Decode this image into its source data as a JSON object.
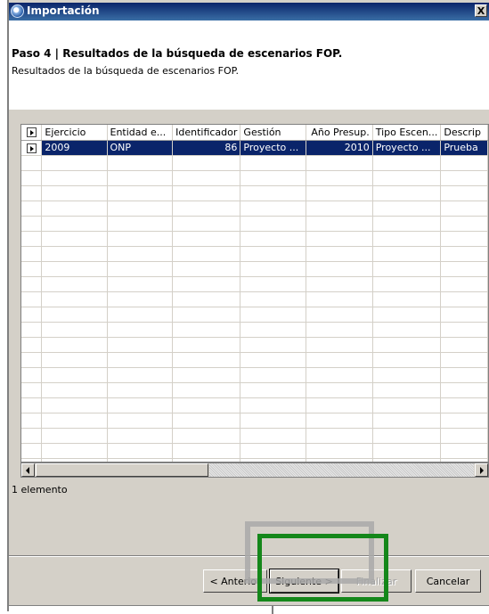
{
  "window": {
    "title": "Importación",
    "close_glyph": "X"
  },
  "header": {
    "step_title": "Paso 4 | Resultados de la búsqueda de escenarios FOP.",
    "step_description": "Resultados de la búsqueda de escenarios FOP."
  },
  "grid": {
    "columns": [
      "Ejercicio",
      "Entidad e...",
      "Identificador",
      "Gestión",
      "Año Presup.",
      "Tipo Escen...",
      "Descrip"
    ],
    "rows": [
      {
        "selected": true,
        "cells": [
          "2009",
          "ONP",
          "86",
          "Proyecto ...",
          "2010",
          "Proyecto ...",
          "Prueba"
        ]
      }
    ]
  },
  "status": {
    "count_label": "1 elemento"
  },
  "buttons": {
    "previous": "< Anterior",
    "next": "Siguiente >",
    "finish": "Finalizar",
    "cancel": "Cancelar"
  },
  "colors": {
    "selection": "#0a246a",
    "highlight_green": "#14871a",
    "highlight_gray": "#a9a9a9"
  }
}
